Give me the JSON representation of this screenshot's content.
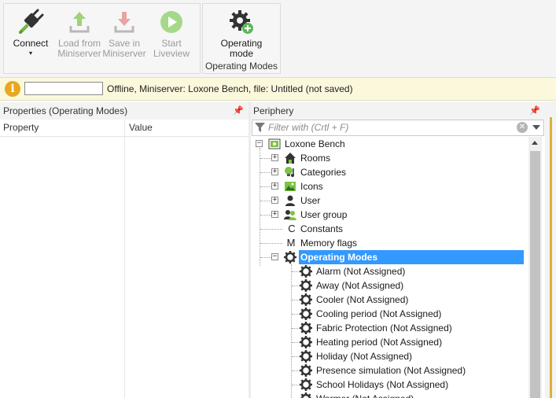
{
  "ribbon": {
    "connect": {
      "label": "Connect",
      "caret": "▾",
      "icon": "connect-plug-icon"
    },
    "load": {
      "line1": "Load from",
      "line2": "Miniserver",
      "icon": "upload-arrow-icon"
    },
    "save": {
      "line1": "Save in",
      "line2": "Miniserver",
      "icon": "download-arrow-icon"
    },
    "liveview": {
      "line1": "Start",
      "line2": "Liveview",
      "icon": "play-circle-icon"
    },
    "operating_mode": {
      "line1": "Operating",
      "line2": "mode",
      "icon": "gear-add-icon"
    },
    "group_label": "Operating Modes"
  },
  "status": {
    "text": "Offline, Miniserver: Loxone Bench, file: Untitled (not saved)",
    "input_value": ""
  },
  "properties": {
    "title": "Properties (Operating Modes)",
    "col_property": "Property",
    "col_value": "Value",
    "pin": "📌"
  },
  "periphery": {
    "title": "Periphery",
    "pin": "📌",
    "filter_placeholder": "Filter with (Crtl + F)",
    "clear": "✕",
    "tree": {
      "root": "Loxone Bench",
      "items": [
        {
          "label": "Rooms",
          "icon": "house-icon"
        },
        {
          "label": "Categories",
          "icon": "lightbulb-music-icon"
        },
        {
          "label": "Icons",
          "icon": "picture-icon"
        },
        {
          "label": "User",
          "icon": "user-icon"
        },
        {
          "label": "User group",
          "icon": "user-group-icon"
        },
        {
          "label": "Constants",
          "icon": "constant-c-icon"
        },
        {
          "label": "Memory flags",
          "icon": "memory-m-icon"
        },
        {
          "label": "Operating Modes",
          "icon": "gear-icon"
        }
      ],
      "modes": [
        "Alarm (Not Assigned)",
        "Away (Not Assigned)",
        "Cooler (Not Assigned)",
        "Cooling period (Not Assigned)",
        "Fabric Protection (Not Assigned)",
        "Heating period (Not Assigned)",
        "Holiday (Not Assigned)",
        "Presence simulation (Not Assigned)",
        "School Holidays (Not Assigned)",
        "Warmer (Not Assigned)"
      ]
    }
  },
  "colors": {
    "selection": "#3399ff",
    "accent_green": "#6cbf43",
    "status_bg": "#fbf8dc",
    "info": "#e9a71f"
  }
}
